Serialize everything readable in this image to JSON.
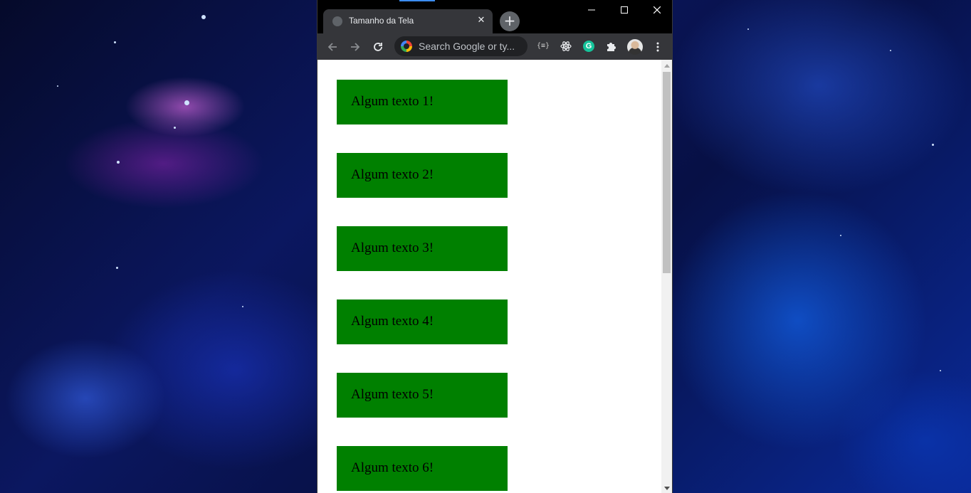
{
  "desktop": {
    "wallpaper": "galaxy nebula wallpaper",
    "colors": {
      "deep": "#050a2a",
      "blue": "#1a4dff",
      "magenta": "#c040e0"
    }
  },
  "browser": {
    "tab": {
      "title": "Tamanho da Tela",
      "favicon": "globe-icon",
      "close": "✕"
    },
    "new_tab": "+",
    "window_controls": [
      "minimize-icon",
      "maximize-icon",
      "close-icon"
    ],
    "toolbar": {
      "back": "back-arrow-icon",
      "forward": "forward-arrow-icon",
      "reload": "reload-icon",
      "omnibox_text": "Search Google or ty...",
      "extensions": [
        "braces-extension-icon",
        "react-extension-icon",
        "grammarly-extension-icon",
        "puzzle-extensions-icon"
      ],
      "ext_braces_label": "{≡}",
      "ext_grammarly_label": "G",
      "menu": "more-vert-icon"
    },
    "colors": {
      "titlebar": "#000000",
      "tab": "#35363a",
      "toolbar": "#35363a",
      "omnibox": "#202124"
    }
  },
  "page": {
    "boxes": [
      {
        "text": "Algum texto 1!"
      },
      {
        "text": "Algum texto 2!"
      },
      {
        "text": "Algum texto 3!"
      },
      {
        "text": "Algum texto 4!"
      },
      {
        "text": "Algum texto 5!"
      },
      {
        "text": "Algum texto 6!"
      }
    ],
    "box_color": "#008000"
  }
}
